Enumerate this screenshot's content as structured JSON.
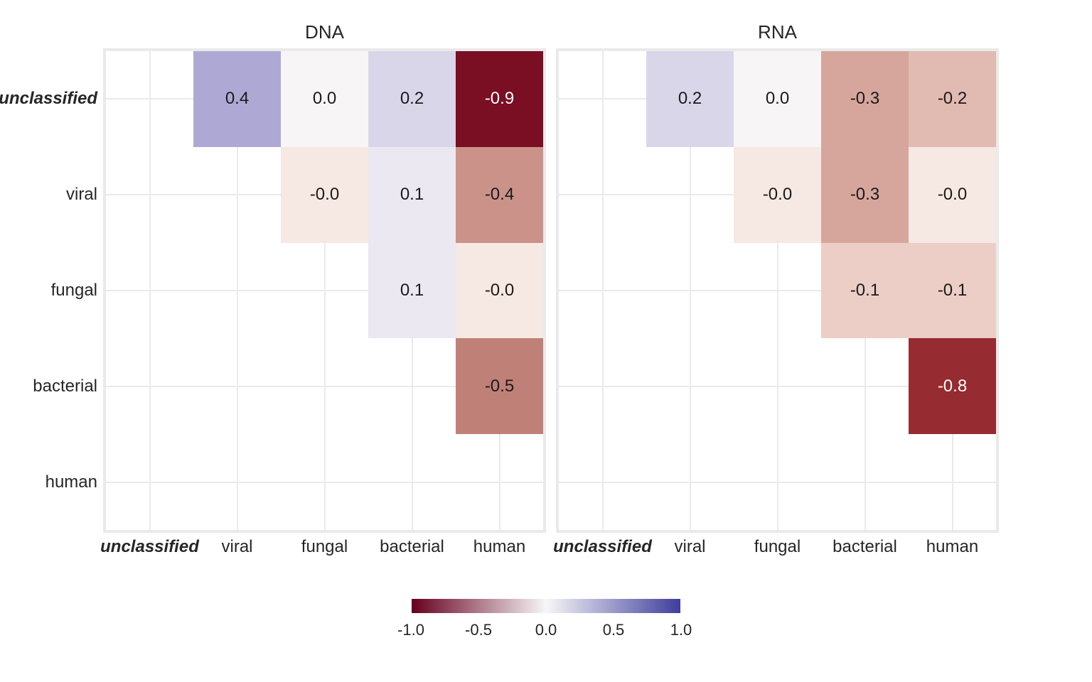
{
  "categories": [
    "unclassified",
    "viral",
    "fungal",
    "bacterial",
    "human"
  ],
  "em_category": "unclassified",
  "color_scale": {
    "min": -1.0,
    "max": 1.0,
    "neg": "#67001f",
    "zero": "#f7f6f7",
    "pos": "#3f3e9c"
  },
  "palette": {
    "-1.0": "#67001f",
    "-0.9": "#7a0e22",
    "-0.8": "#962b31",
    "-0.5": "#bf8078",
    "-0.4": "#cb9289",
    "-0.3": "#d6a69d",
    "-0.2": "#e1bab1",
    "-0.1": "#eccec6",
    "-0.0": "#f6e8e3",
    "0.0": "#f8f5f7",
    "0.1": "#ebe8f2",
    "0.2": "#dad6ea",
    "0.3": "#c7c2e0",
    "0.4": "#aea9d4",
    "0.5": "#9690c9",
    "1.0": "#3f3e9c"
  },
  "colorbar_ticks": [
    "-1.0",
    "-0.5",
    "0.0",
    "0.5",
    "1.0"
  ],
  "chart_data": [
    {
      "type": "heatmap",
      "title": "DNA",
      "xlabel": "",
      "ylabel": "",
      "x_categories": [
        "unclassified",
        "viral",
        "fungal",
        "bacterial",
        "human"
      ],
      "y_categories": [
        "unclassified",
        "viral",
        "fungal",
        "bacterial",
        "human"
      ],
      "cells": [
        {
          "row": "unclassified",
          "col": "viral",
          "value": 0.4,
          "label": "0.4"
        },
        {
          "row": "unclassified",
          "col": "fungal",
          "value": 0.0,
          "label": "0.0"
        },
        {
          "row": "unclassified",
          "col": "bacterial",
          "value": 0.2,
          "label": "0.2"
        },
        {
          "row": "unclassified",
          "col": "human",
          "value": -0.9,
          "label": "-0.9"
        },
        {
          "row": "viral",
          "col": "fungal",
          "value": -0.0,
          "label": "-0.0"
        },
        {
          "row": "viral",
          "col": "bacterial",
          "value": 0.1,
          "label": "0.1"
        },
        {
          "row": "viral",
          "col": "human",
          "value": -0.4,
          "label": "-0.4"
        },
        {
          "row": "fungal",
          "col": "bacterial",
          "value": 0.1,
          "label": "0.1"
        },
        {
          "row": "fungal",
          "col": "human",
          "value": -0.0,
          "label": "-0.0"
        },
        {
          "row": "bacterial",
          "col": "human",
          "value": -0.5,
          "label": "-0.5"
        }
      ]
    },
    {
      "type": "heatmap",
      "title": "RNA",
      "xlabel": "",
      "ylabel": "",
      "x_categories": [
        "unclassified",
        "viral",
        "fungal",
        "bacterial",
        "human"
      ],
      "y_categories": [
        "unclassified",
        "viral",
        "fungal",
        "bacterial",
        "human"
      ],
      "cells": [
        {
          "row": "unclassified",
          "col": "viral",
          "value": 0.2,
          "label": "0.2"
        },
        {
          "row": "unclassified",
          "col": "fungal",
          "value": 0.0,
          "label": "0.0"
        },
        {
          "row": "unclassified",
          "col": "bacterial",
          "value": -0.3,
          "label": "-0.3"
        },
        {
          "row": "unclassified",
          "col": "human",
          "value": -0.2,
          "label": "-0.2"
        },
        {
          "row": "viral",
          "col": "fungal",
          "value": -0.0,
          "label": "-0.0"
        },
        {
          "row": "viral",
          "col": "bacterial",
          "value": -0.3,
          "label": "-0.3"
        },
        {
          "row": "viral",
          "col": "human",
          "value": -0.0,
          "label": "-0.0"
        },
        {
          "row": "fungal",
          "col": "bacterial",
          "value": -0.1,
          "label": "-0.1"
        },
        {
          "row": "fungal",
          "col": "human",
          "value": -0.1,
          "label": "-0.1"
        },
        {
          "row": "bacterial",
          "col": "human",
          "value": -0.8,
          "label": "-0.8"
        }
      ]
    }
  ]
}
